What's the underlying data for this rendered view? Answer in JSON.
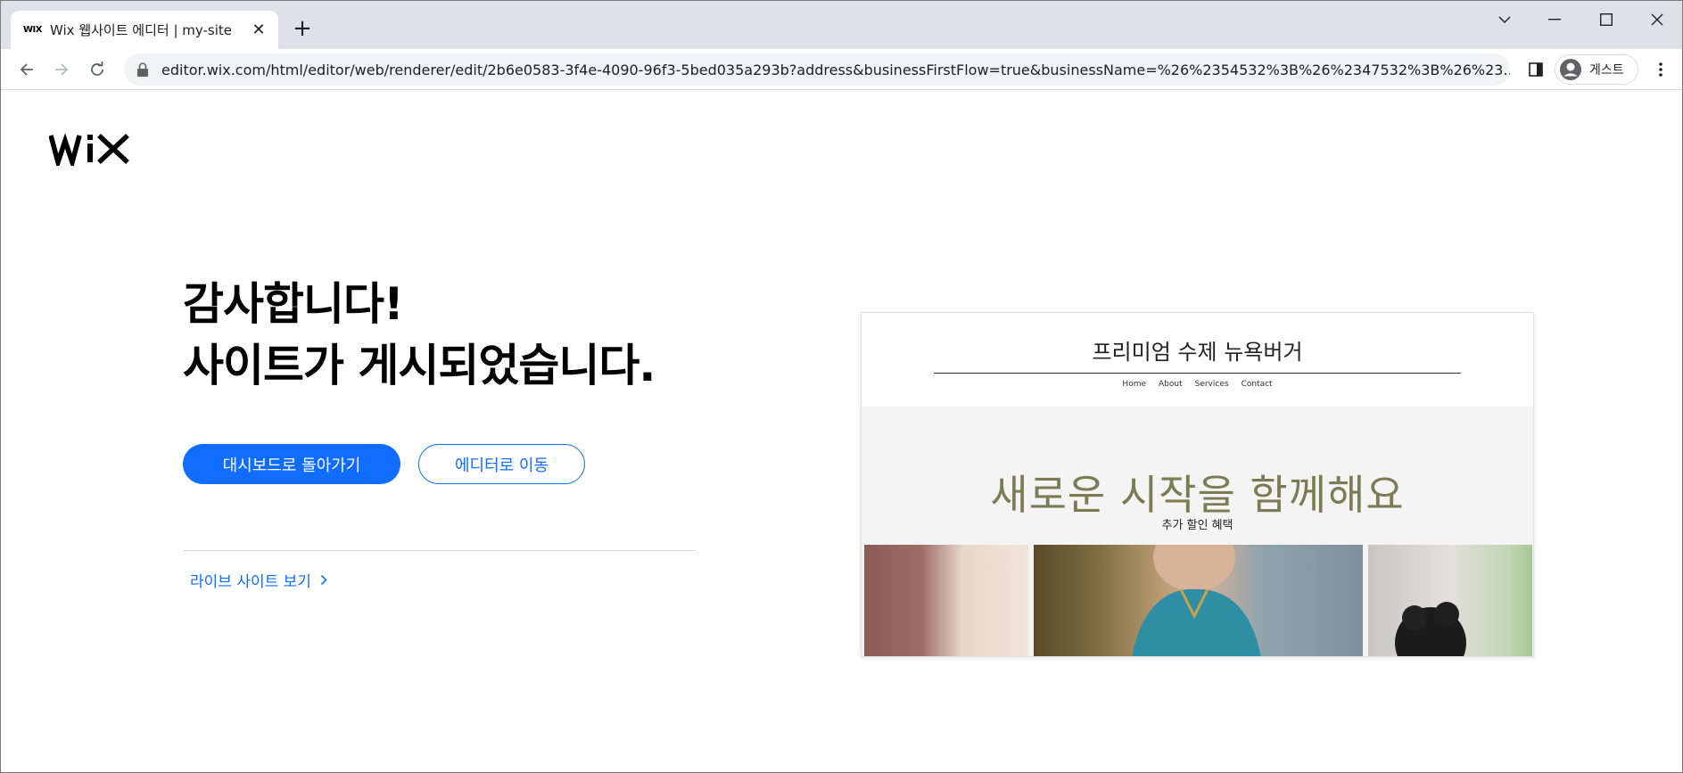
{
  "browser": {
    "tab": {
      "favicon_text": "WIX",
      "title": "Wix 웹사이트 에디터 | my-site"
    },
    "url": "editor.wix.com/html/editor/web/renderer/edit/2b6e0583-3f4e-4090-96f3-5bed035a293b?address&businessFirstFlow=true&businessName=%26%2354532%3B%26%2347532%3B%26%23...",
    "profile_label": "게스트"
  },
  "page": {
    "heading_line1": "감사합니다!",
    "heading_line2": "사이트가 게시되었습니다.",
    "primary_button": "대시보드로 돌아가기",
    "secondary_button": "에디터로 이동",
    "live_site_link": "라이브 사이트 보기"
  },
  "preview": {
    "site_title": "프리미엄 수제 뉴욕버거",
    "nav": [
      "Home",
      "About",
      "Services",
      "Contact"
    ],
    "hero_title": "새로운 시작을 함께해요",
    "hero_subtitle": "추가 할인 혜택"
  },
  "colors": {
    "accent": "#116dff",
    "hero_title": "#7b7c54",
    "tabstrip": "#dee1e6"
  }
}
